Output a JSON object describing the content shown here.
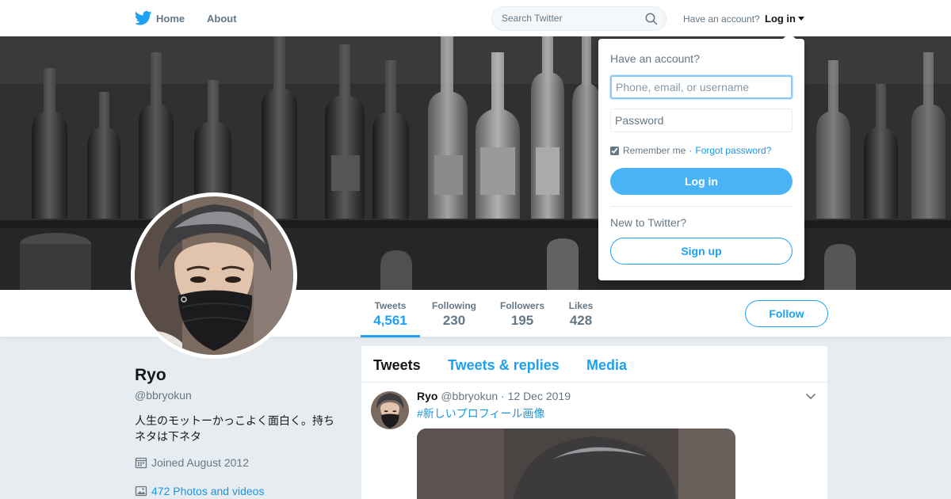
{
  "topbar": {
    "home_label": "Home",
    "about_label": "About",
    "search_placeholder": "Search Twitter",
    "have_account": "Have an account?",
    "login_label": "Log in"
  },
  "profile": {
    "name": "Ryo",
    "handle": "@bbryokun",
    "bio": "人生のモットーかっこよく面白く。持ちネタは下ネタ",
    "joined": "Joined August 2012",
    "photos": "472 Photos and videos"
  },
  "stats": [
    {
      "label": "Tweets",
      "value": "4,561",
      "active": true
    },
    {
      "label": "Following",
      "value": "230",
      "active": false
    },
    {
      "label": "Followers",
      "value": "195",
      "active": false
    },
    {
      "label": "Likes",
      "value": "428",
      "active": false
    }
  ],
  "follow_label": "Follow",
  "timeline": {
    "tabs": [
      {
        "label": "Tweets",
        "active": true
      },
      {
        "label": "Tweets & replies",
        "active": false
      },
      {
        "label": "Media",
        "active": false
      }
    ],
    "tweet": {
      "name": "Ryo",
      "handle": "@bbryokun",
      "dot": "·",
      "date": "12 Dec 2019",
      "text": "#新しいプロフィール画像"
    }
  },
  "login_dropdown": {
    "title": "Have an account?",
    "username_placeholder": "Phone, email, or username",
    "password_placeholder": "Password",
    "remember_label": "Remember me",
    "separator": "·",
    "forgot_label": "Forgot password?",
    "login_button": "Log in",
    "new_label": "New to Twitter?",
    "signup_button": "Sign up"
  },
  "colors": {
    "accent": "#1da1f2",
    "link": "#1b95e0",
    "muted": "#657786",
    "background": "#e6ecf0"
  },
  "icons": [
    "twitter-bird-icon",
    "search-icon",
    "chevron-down-icon",
    "calendar-icon",
    "image-icon"
  ]
}
